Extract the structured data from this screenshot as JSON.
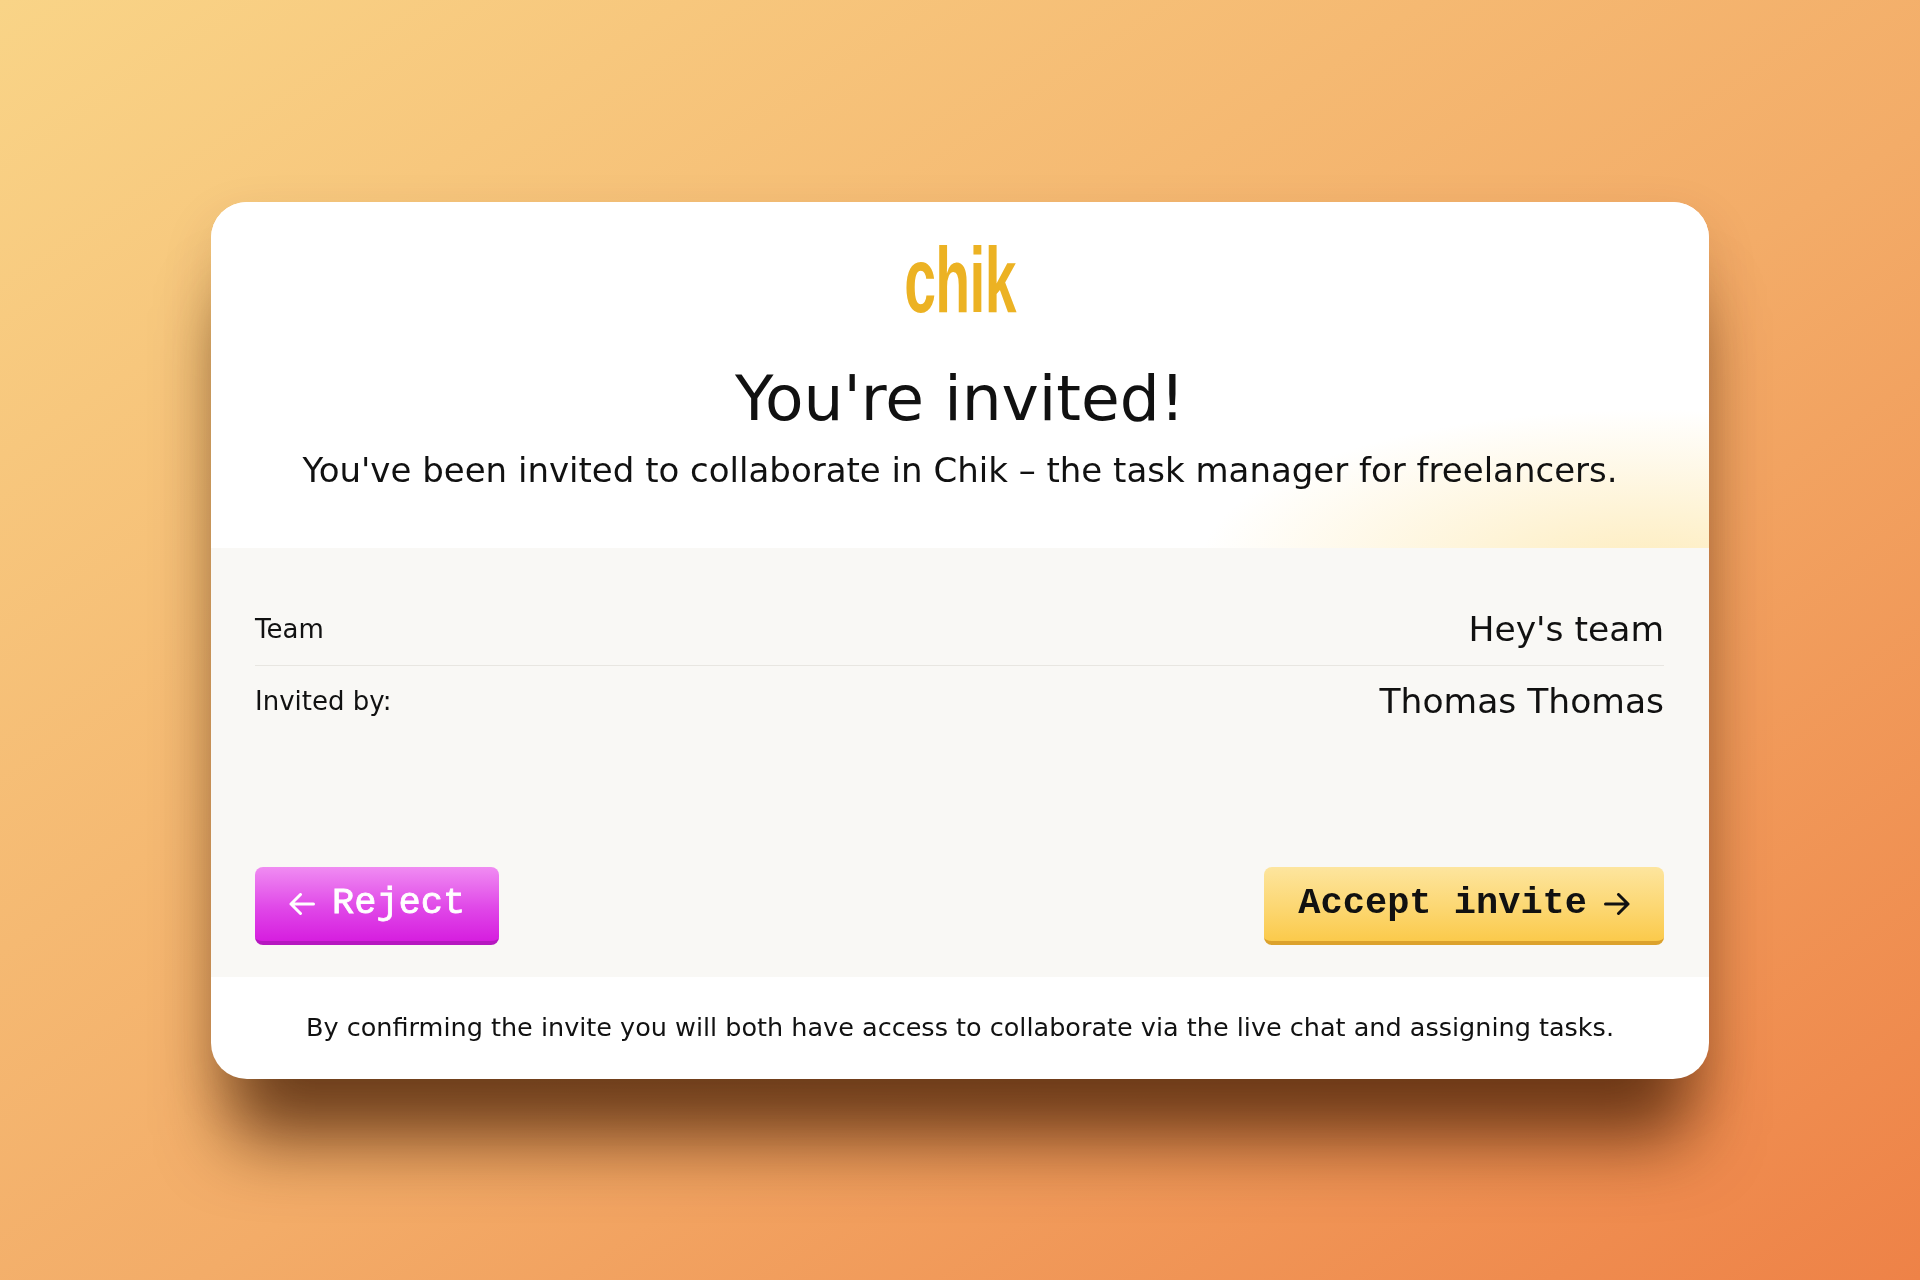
{
  "logo": {
    "text": "chik"
  },
  "title": "You're invited!",
  "subtitle": "You've been invited to collaborate in Chik – the task manager for freelancers.",
  "details": [
    {
      "label": "Team",
      "value": "Hey's team"
    },
    {
      "label": "Invited by:",
      "value": "Thomas Thomas"
    }
  ],
  "actions": [
    {
      "kind": "reject",
      "label": "Reject"
    },
    {
      "kind": "accept",
      "label": "Accept invite"
    }
  ],
  "footnote": "By confirming the invite you will both have access to collaborate via the live chat and assigning tasks."
}
